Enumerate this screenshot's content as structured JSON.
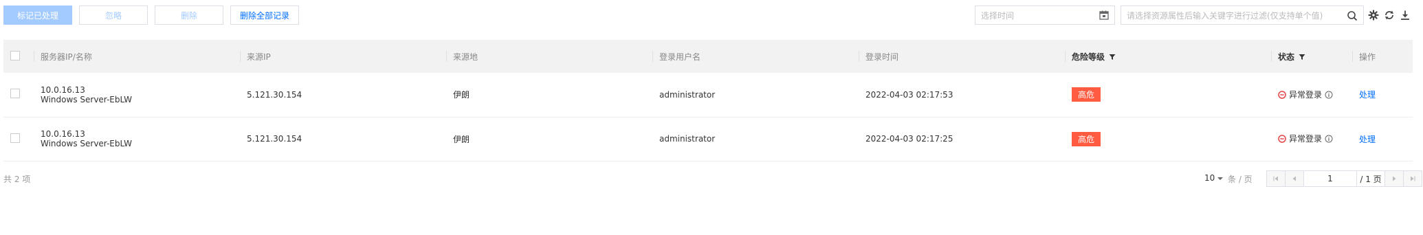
{
  "toolbar": {
    "mark_processed": "标记已处理",
    "ignore": "忽略",
    "delete": "删除",
    "delete_all": "删除全部记录"
  },
  "filters": {
    "date_placeholder": "选择时间",
    "search_placeholder": "请选择资源属性后输入关键字进行过滤(仅支持单个值)"
  },
  "table": {
    "columns": [
      "服务器IP/名称",
      "来源IP",
      "来源地",
      "登录用户名",
      "登录时间",
      "危险等级",
      "状态",
      "操作"
    ],
    "rows": [
      {
        "server_ip": "10.0.16.13",
        "server_name": "Windows Server-EbLW",
        "source_ip": "5.121.30.154",
        "location": "伊朗",
        "username": "administrator",
        "login_time": "2022-04-03 02:17:53",
        "risk": "高危",
        "status": "异常登录",
        "action": "处理"
      },
      {
        "server_ip": "10.0.16.13",
        "server_name": "Windows Server-EbLW",
        "source_ip": "5.121.30.154",
        "location": "伊朗",
        "username": "administrator",
        "login_time": "2022-04-03 02:17:25",
        "risk": "高危",
        "status": "异常登录",
        "action": "处理"
      }
    ]
  },
  "footer": {
    "total": "共 2 项",
    "page_size": "10",
    "page_size_unit": "条 / 页",
    "current_page": "1",
    "total_pages": "/ 1 页"
  },
  "colors": {
    "accent": "#006eff",
    "danger": "#ff5b40",
    "status_icon": "#e54545"
  },
  "icons": {
    "calendar": "calendar-icon",
    "search": "search-icon",
    "settings": "gear-icon",
    "refresh": "refresh-icon",
    "download": "download-icon",
    "filter": "filter-icon",
    "status": "error-circle-icon",
    "info": "info-icon"
  }
}
